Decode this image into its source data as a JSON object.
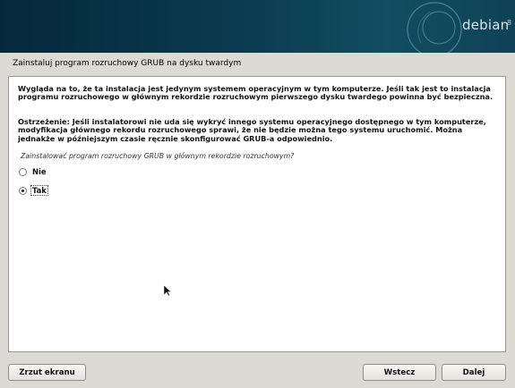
{
  "header": {
    "logo_text": "debian",
    "logo_mark": "8"
  },
  "page": {
    "title": "Zainstaluj program rozruchowy GRUB na dysku twardym"
  },
  "content": {
    "paragraph1": "Wygląda na to, że ta instalacja jest jedynym systemem operacyjnym w tym komputerze. Jeśli tak jest to instalacja programu rozruchowego w głównym rekordzie rozruchowym pierwszego dysku twardego powinna być bezpieczna.",
    "paragraph2": "Ostrzeżenie: Jeśli instalatorowi nie uda się wykryć innego systemu operacyjnego dostępnego w tym komputerze, modyfikacja głównego rekordu rozruchowego sprawi, że nie będzie można tego systemu uruchomić. Można jednakże w późniejszym czasie ręcznie skonfigurować GRUB-a odpowiednio.",
    "question": "Zainstalować program rozruchowy GRUB w głównym rekordzie rozruchowym?",
    "options": [
      {
        "label": "Nie",
        "selected": false
      },
      {
        "label": "Tak",
        "selected": true
      }
    ]
  },
  "buttons": {
    "screenshot": "Zrzut ekranu",
    "back": "Wstecz",
    "continue": "Dalej"
  },
  "colors": {
    "banner": "#0a3a4f",
    "background": "#dcdad5",
    "panel": "#ffffff"
  }
}
